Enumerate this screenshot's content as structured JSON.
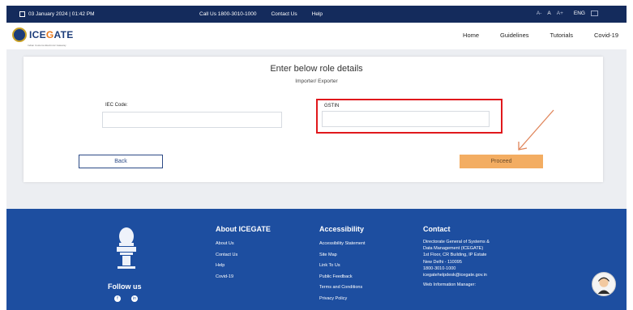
{
  "topbar": {
    "date": "03 January 2024 | 01:42 PM",
    "call_us": "Call Us  1800-3010-1000",
    "contact_us": "Contact Us",
    "help": "Help",
    "font_small": "A-",
    "font_normal": "A",
    "font_large": "A+",
    "language": "ENG"
  },
  "header": {
    "logo_prefix": "ICE",
    "logo_accent": "G",
    "logo_suffix": "ATE",
    "logo_tagline": "Indian Customs Electronic Gateway",
    "nav": [
      "Home",
      "Guidelines",
      "Tutorials",
      "Covid-19"
    ]
  },
  "form": {
    "title": "Enter below role details",
    "subtitle": "Importer/ Exporter",
    "iec_label": "IEC Code:",
    "iec_value": "",
    "gstin_label": "GSTIN",
    "gstin_value": "",
    "back_label": "Back",
    "proceed_label": "Proceed"
  },
  "footer": {
    "about": {
      "heading": "About ICEGATE",
      "items": [
        "About Us",
        "Contact Us",
        "Help",
        "Covid-19"
      ]
    },
    "accessibility": {
      "heading": "Accessibility",
      "items": [
        "Accessibility Statement",
        "Site Map",
        "Link To Us",
        "Public Feedback",
        "Terms and Conditions",
        "Privacy Policy"
      ]
    },
    "contact": {
      "heading": "Contact",
      "lines": [
        "Directorate General of Systems &",
        "Data Management (ICEGATE)",
        "1st Floor, CR Building, IP Estate",
        "New Delhi - 110095",
        "1800-3010-1000",
        "icegatehelpdesk@icegate.gov.in",
        "Web Information Manager:"
      ]
    },
    "follow_us": "Follow us"
  },
  "colors": {
    "topbar": "#142b5c",
    "footer": "#1d4ea0",
    "proceed": "#f3ad62",
    "highlight": "#e0181c"
  }
}
